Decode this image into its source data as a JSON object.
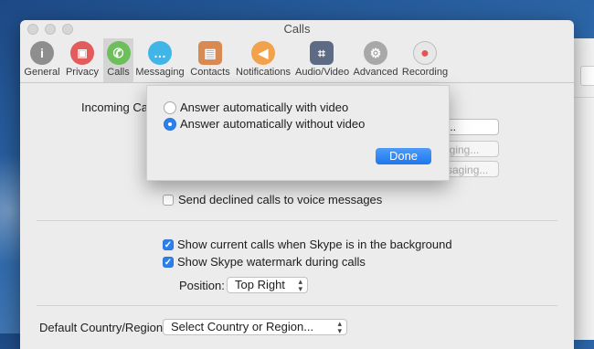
{
  "window": {
    "title": "Calls"
  },
  "toolbar": {
    "items": [
      {
        "label": "General",
        "icon": "info-icon",
        "color": "#8e8e8e",
        "glyph": "i"
      },
      {
        "label": "Privacy",
        "icon": "lock-icon",
        "color": "#e25c5c",
        "glyph": "🔒"
      },
      {
        "label": "Calls",
        "icon": "phone-icon",
        "color": "#6cbf5a",
        "glyph": "✆"
      },
      {
        "label": "Messaging",
        "icon": "chat-bubble-icon",
        "color": "#3fb5e8",
        "glyph": "…"
      },
      {
        "label": "Contacts",
        "icon": "address-book-icon",
        "color": "#d88a52",
        "glyph": "▤"
      },
      {
        "label": "Notifications",
        "icon": "megaphone-icon",
        "color": "#f2a24a",
        "glyph": "📢"
      },
      {
        "label": "Audio/Video",
        "icon": "keypad-icon",
        "color": "#5d6b85",
        "glyph": "⌗"
      },
      {
        "label": "Advanced",
        "icon": "gear-icon",
        "color": "#a8a8a8",
        "glyph": "⚙"
      },
      {
        "label": "Recording",
        "icon": "record-icon",
        "color": "#e45454",
        "glyph": "●"
      }
    ]
  },
  "incoming_calls": {
    "label": "Incoming Cal",
    "partial_buttons": [
      "...",
      "iging...",
      "saging..."
    ]
  },
  "sheet": {
    "options": [
      {
        "label": "Answer automatically with video",
        "selected": false
      },
      {
        "label": "Answer automatically without video",
        "selected": true
      }
    ],
    "done_label": "Done"
  },
  "declined": {
    "label": "Send declined calls to voice messages",
    "checked": false
  },
  "show_current_calls": {
    "label": "Show current calls when Skype is in the background",
    "checked": true
  },
  "watermark": {
    "label": "Show Skype watermark during calls",
    "checked": true
  },
  "position": {
    "label": "Position:",
    "value": "Top Right"
  },
  "country": {
    "label": "Default Country/Region:",
    "value": "Select Country or Region..."
  },
  "colors": {
    "accent": "#2d7fee",
    "window_bg": "#ececec"
  }
}
